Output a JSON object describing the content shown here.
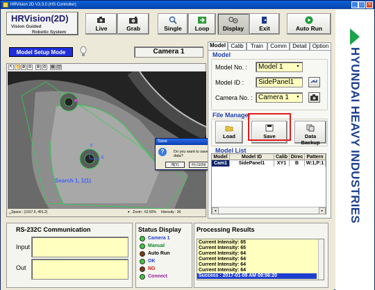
{
  "window": {
    "title": "HRVision 2D V3.3.0 (HS Controller)"
  },
  "app_logo": {
    "line1": "HRVision(2D)",
    "line2": "Vision Guided",
    "line3": "Robotic System"
  },
  "toolbar": [
    {
      "label": "Live",
      "icon": "camera-icon"
    },
    {
      "label": "Grab",
      "icon": "camera-grab-icon"
    },
    {
      "label": "Single",
      "icon": "magnifier-icon"
    },
    {
      "label": "Loop",
      "icon": "loop-arrow-icon"
    },
    {
      "label": "Display",
      "icon": "display-tools-icon"
    },
    {
      "label": "Exit",
      "icon": "exit-door-icon"
    },
    {
      "label": "Auto Run",
      "icon": "play-icon"
    }
  ],
  "brand": {
    "text": "HYUNDAI HEAVY INDUSTRIES",
    "color": "#1b3f8f",
    "accent": "#1aa34a"
  },
  "mode": {
    "label": "Model Setup Mode",
    "camera_title": "Camera 1"
  },
  "viewer": {
    "tools": [
      "↖",
      "✋",
      "⊕",
      "⊖",
      "⊕",
      "⊖",
      "▦",
      "▥"
    ],
    "overlay_label": "Search 1, 1(1)",
    "axis_x": "X",
    "axis_y": "Y",
    "status_space": "␣Space : (1917.6, 491.2)",
    "status_zoom": "Zoom : 62.50%",
    "status_intensity": "Intensity : 36"
  },
  "dialog": {
    "title": "Save",
    "message": "Do you want to save data?",
    "yes": "예(Y)",
    "no": "아니오(N)"
  },
  "tabs": [
    "Model",
    "Calib",
    "Train",
    "Comm",
    "Detail",
    "Option"
  ],
  "model_group": {
    "title": "Model",
    "model_no_label": "Model No.  :",
    "model_no": "Model 1",
    "model_id_label": "Model ID  :",
    "model_id": "SidePanel1",
    "camera_no_label": "Camera No. :",
    "camera_no": "Camera 1"
  },
  "file_manager": {
    "title": "File Manager",
    "load": "Load",
    "save": "Save",
    "backup": "Data Backup"
  },
  "model_list": {
    "title": "Model List",
    "columns": [
      "Model",
      "Model ID",
      "Calib",
      "Direc",
      "Pattern"
    ],
    "rows": [
      [
        "Cam1",
        "SidePanel1",
        "XY1",
        "B",
        "W:1,P:1"
      ]
    ]
  },
  "rs232": {
    "title": "RS-232C Communication",
    "input_label": "Input",
    "out_label": "Out"
  },
  "status_display": {
    "title": "Status Display",
    "items": [
      {
        "label": "Camera 1",
        "color": "#3ec83e",
        "text_color": "#1f3fd0"
      },
      {
        "label": "Manual",
        "color": "#3ec83e",
        "text_color": "#118a2a"
      },
      {
        "label": "Auto Run",
        "color": "#7a3a10",
        "text_color": "#000000"
      },
      {
        "label": "OK",
        "color": "#3ec83e",
        "text_color": "#1f3fd0"
      },
      {
        "label": "NG",
        "color": "#7a3a10",
        "text_color": "#d01818"
      },
      {
        "label": "Connect",
        "color": "#3ec83e",
        "text_color": "#9a1a9a"
      }
    ]
  },
  "processing": {
    "title": "Processing Results",
    "lines": [
      "Current Intensity: 65",
      "Current Intensity: 65",
      "Current Intensity: 64",
      "Current Intensity: 64",
      "Current Intensity: 64",
      "Current Intensity: 64",
      "Success : 2017-01-09 AM 09:56:20"
    ]
  }
}
